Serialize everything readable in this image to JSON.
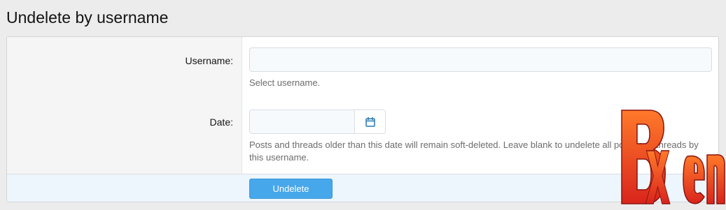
{
  "page": {
    "title": "Undelete by username"
  },
  "form": {
    "username": {
      "label": "Username:",
      "value": "",
      "placeholder": "",
      "explain": "Select username."
    },
    "date": {
      "label": "Date:",
      "value": "",
      "placeholder": "",
      "button_icon": "calendar-icon",
      "explain": "Posts and threads older than this date will remain soft-deleted. Leave blank to undelete all posts and threads by this username."
    },
    "submit_label": "Undelete"
  },
  "watermark": {
    "text": "Bxen",
    "colors": [
      "#ff5a1f",
      "#d9241c"
    ]
  },
  "colors": {
    "accent": "#47a7eb",
    "icon": "#2577b1"
  }
}
